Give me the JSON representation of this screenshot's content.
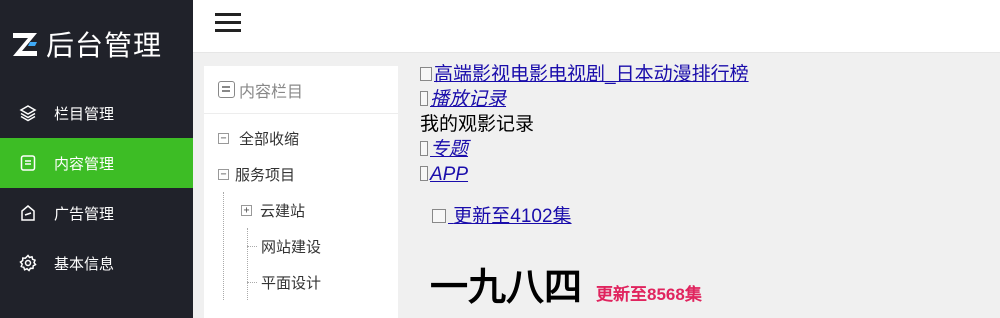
{
  "app": {
    "title": "后台管理"
  },
  "sidebar": {
    "items": [
      {
        "label": "栏目管理",
        "icon": "layers-icon",
        "active": false
      },
      {
        "label": "内容管理",
        "icon": "document-icon",
        "active": true
      },
      {
        "label": "广告管理",
        "icon": "ad-icon",
        "active": false
      },
      {
        "label": "基本信息",
        "icon": "gear-icon",
        "active": false
      }
    ],
    "active_color": "#3dbd25",
    "bg_color": "#20222a"
  },
  "tree": {
    "header": "内容栏目",
    "items": [
      "全部收缩",
      "服务项目",
      "云建站",
      "网站建设",
      "平面设计"
    ]
  },
  "content": {
    "img_alt": "高端影视电影电视剧_日本动漫排行榜",
    "link_history": "播放记录",
    "history_text": "我的观影记录",
    "link_topic": "专题",
    "link_app": "APP",
    "update_link": "更新至4102集",
    "title": "一九八四",
    "title_update": "更新至8568集",
    "update_color": "#e0245e"
  }
}
